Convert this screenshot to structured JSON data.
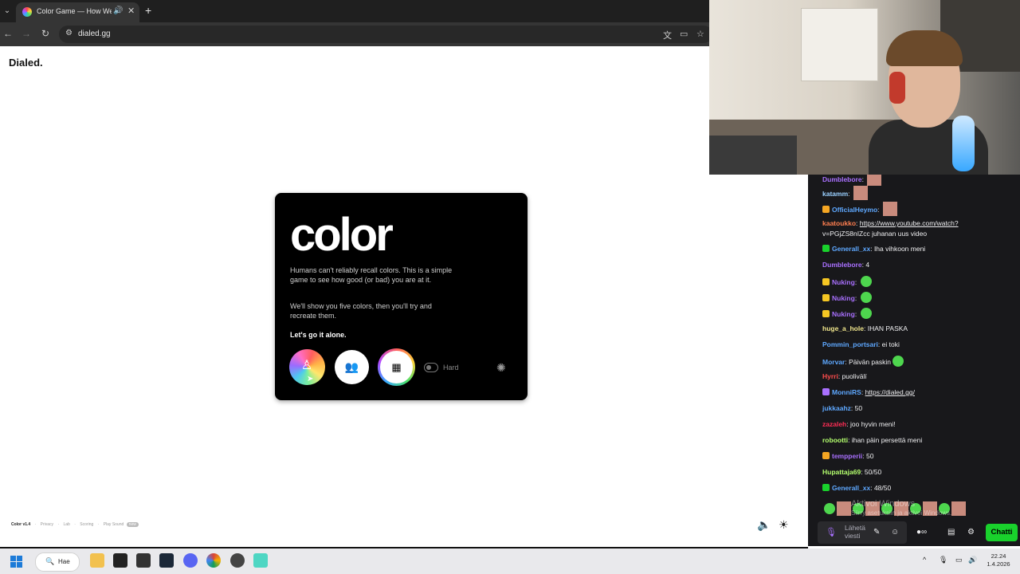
{
  "browser": {
    "tab_title": "Color Game — How Well C",
    "url": "dialed.gg",
    "tab_new_symbol": "+",
    "tab_close_symbol": "✕",
    "tab_audio_symbol": "🔊"
  },
  "page": {
    "logo": "Dialed.",
    "card": {
      "title": "color",
      "paragraph1": "Humans can't reliably recall colors. This is a simple game to see how good (or bad) you are at it.",
      "paragraph2": "We'll show you five colors, then you'll try and recreate them.",
      "cta": "Let's go it alone.",
      "hard_label": "Hard",
      "hard_toggle_on": false
    },
    "footer": {
      "version": "Color v1.4",
      "links": [
        "Privacy",
        "Lab",
        "Scoring",
        "Play Sound"
      ],
      "badge": "new"
    }
  },
  "chat": {
    "messages": [
      {
        "user": "Dumblebore",
        "color": "#a970ff",
        "text": "",
        "emote": "img"
      },
      {
        "user": "katamm",
        "color": "#9ad0ff",
        "text": "",
        "emote": "img"
      },
      {
        "user": "OfficialHeymo",
        "color": "#5ea8ff",
        "text": "",
        "emote": "img",
        "badge": "#f5a623"
      },
      {
        "user": "kaatoukko",
        "color": "#ff7f50",
        "text": "https://www.youtube.com/watch?",
        "link": true
      },
      {
        "user": "",
        "color": "#efeff1",
        "text": "v=PGjZS8nIZcc juhanan uus video",
        "cont": true
      },
      {
        "user": "Generall_xx",
        "color": "#5ea8ff",
        "text": "Iha vihkoon meni",
        "badge": "#19d12c"
      },
      {
        "user": "Dumblebore",
        "color": "#a970ff",
        "text": "4"
      },
      {
        "user": "Nuking",
        "color": "#a970ff",
        "text": "",
        "emote": "green",
        "badge": "#f5c623"
      },
      {
        "user": "Nuking",
        "color": "#a970ff",
        "text": "",
        "emote": "green",
        "badge": "#f5c623"
      },
      {
        "user": "Nuking",
        "color": "#a970ff",
        "text": "",
        "emote": "green",
        "badge": "#f5c623"
      },
      {
        "user": "huge_a_hole",
        "color": "#f0e68c",
        "text": "IHAN PASKA"
      },
      {
        "user": "Pommin_portsari",
        "color": "#5ea8ff",
        "text": "ei toki"
      },
      {
        "user": "Morvar",
        "color": "#5ea8ff",
        "text": "Päivän paskin",
        "emote": "green"
      },
      {
        "user": "Hyrri",
        "color": "#ff4d4d",
        "text": "puolivälí"
      },
      {
        "user": "MonniRS",
        "color": "#5ea8ff",
        "text": "https://dialed.gg/",
        "link": true,
        "badge": "#a970ff"
      },
      {
        "user": "jukkaahz",
        "color": "#5ea8ff",
        "text": "50"
      },
      {
        "user": "zazaleh",
        "color": "#ff2d55",
        "text": "joo hyvin meni!"
      },
      {
        "user": "robootti",
        "color": "#b4ff6e",
        "text": "ihan päin persettä meni"
      },
      {
        "user": "tempperii",
        "color": "#a970ff",
        "text": "50",
        "badge": "#f5a623"
      },
      {
        "user": "Hupattaja69",
        "color": "#b4ff6e",
        "text": "50/50"
      },
      {
        "user": "Generall_xx",
        "color": "#5ea8ff",
        "text": "48/50",
        "badge": "#19d12c"
      }
    ],
    "send_placeholder": "Lähetä viesti",
    "chat_button": "Chatti",
    "watermark_title": "Aktivoi Windows",
    "watermark_sub": "Siirry asetuksiin ja aktivoi Windows."
  },
  "taskbar": {
    "search_label": "Hae",
    "time": "22.24",
    "date": "1.4.2026"
  },
  "colors": {
    "accent_green": "#19d12c",
    "chat_bg": "#18181b",
    "twitch_purple": "#a970ff"
  }
}
